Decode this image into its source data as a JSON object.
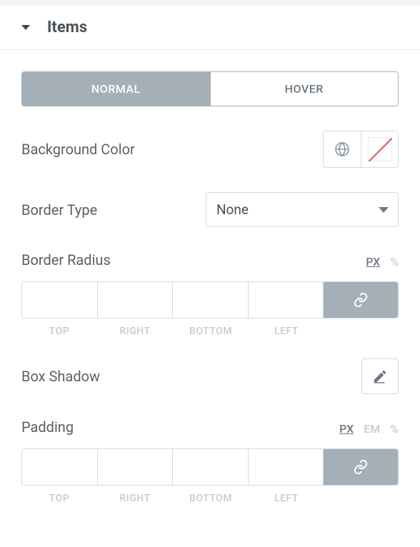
{
  "section": {
    "title": "Items"
  },
  "tabs": {
    "normal": "NORMAL",
    "hover": "HOVER"
  },
  "controls": {
    "bg_color_label": "Background Color",
    "border_type_label": "Border Type",
    "border_type_value": "None",
    "border_radius_label": "Border Radius",
    "box_shadow_label": "Box Shadow",
    "padding_label": "Padding"
  },
  "units": {
    "px": "PX",
    "pct": "%",
    "em": "EM"
  },
  "dim_labels": {
    "top": "TOP",
    "right": "RIGHT",
    "bottom": "BOTTOM",
    "left": "LEFT"
  },
  "border_radius": {
    "top": "",
    "right": "",
    "bottom": "",
    "left": ""
  },
  "padding": {
    "top": "",
    "right": "",
    "bottom": "",
    "left": ""
  }
}
